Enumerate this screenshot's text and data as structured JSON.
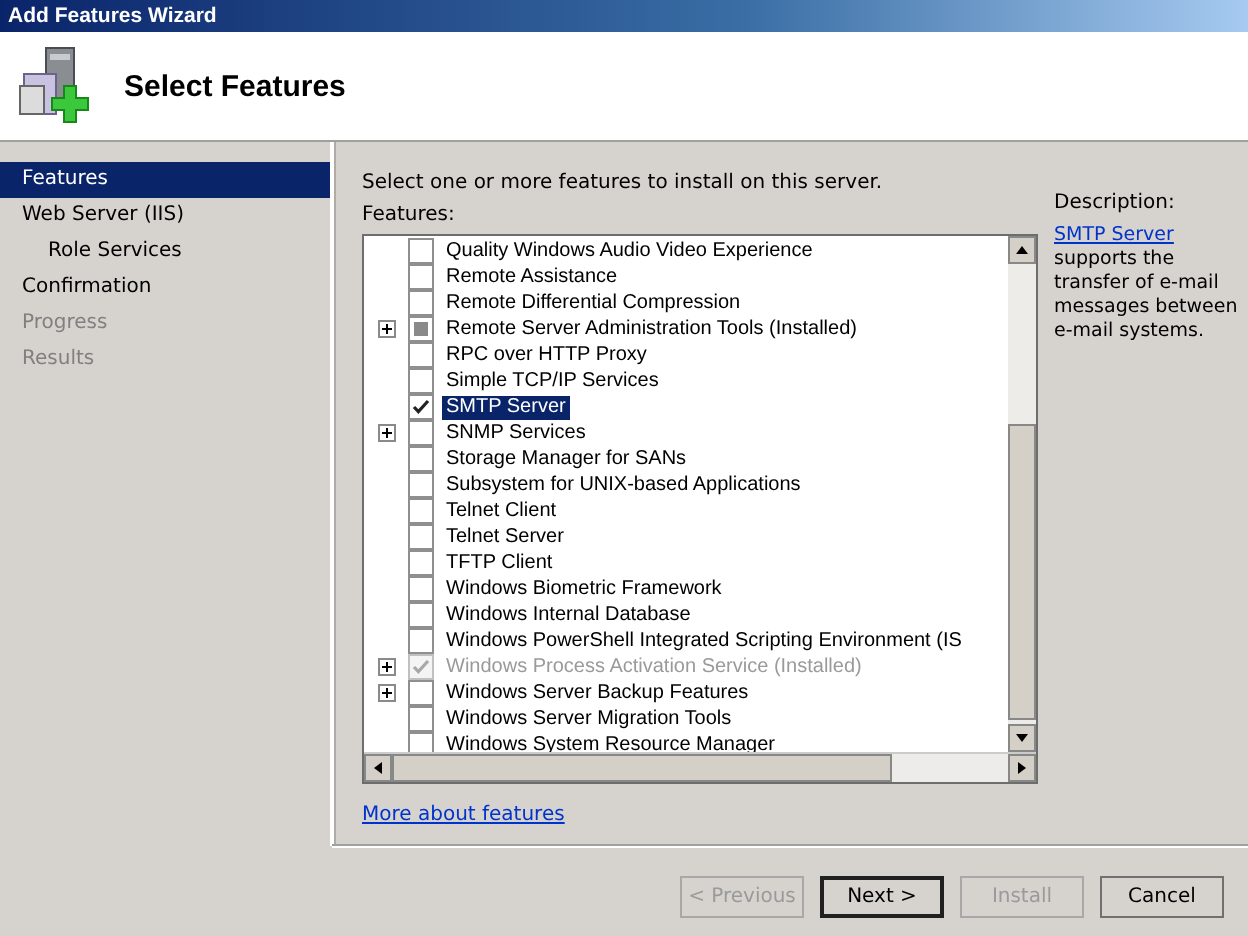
{
  "window": {
    "title": "Add Features Wizard"
  },
  "header": {
    "title": "Select Features"
  },
  "nav": [
    {
      "label": "Features",
      "selected": true,
      "disabled": false
    },
    {
      "label": "Web Server (IIS)",
      "selected": false,
      "disabled": false,
      "children": [
        {
          "label": "Role Services",
          "selected": false,
          "disabled": false
        }
      ]
    },
    {
      "label": "Confirmation",
      "selected": false,
      "disabled": false
    },
    {
      "label": "Progress",
      "selected": false,
      "disabled": true
    },
    {
      "label": "Results",
      "selected": false,
      "disabled": true
    }
  ],
  "instruction": "Select one or more features to install on this server.",
  "features_label": "Features:",
  "features": [
    {
      "label": "Quality Windows Audio Video Experience",
      "checked": false,
      "partial": false,
      "expandable": false,
      "disabled": false,
      "selected": false
    },
    {
      "label": "Remote Assistance",
      "checked": false,
      "partial": false,
      "expandable": false,
      "disabled": false,
      "selected": false
    },
    {
      "label": "Remote Differential Compression",
      "checked": false,
      "partial": false,
      "expandable": false,
      "disabled": false,
      "selected": false
    },
    {
      "label": "Remote Server Administration Tools  (Installed)",
      "checked": false,
      "partial": true,
      "expandable": true,
      "disabled": false,
      "selected": false
    },
    {
      "label": "RPC over HTTP Proxy",
      "checked": false,
      "partial": false,
      "expandable": false,
      "disabled": false,
      "selected": false
    },
    {
      "label": "Simple TCP/IP Services",
      "checked": false,
      "partial": false,
      "expandable": false,
      "disabled": false,
      "selected": false
    },
    {
      "label": "SMTP Server",
      "checked": true,
      "partial": false,
      "expandable": false,
      "disabled": false,
      "selected": true
    },
    {
      "label": "SNMP Services",
      "checked": false,
      "partial": false,
      "expandable": true,
      "disabled": false,
      "selected": false
    },
    {
      "label": "Storage Manager for SANs",
      "checked": false,
      "partial": false,
      "expandable": false,
      "disabled": false,
      "selected": false
    },
    {
      "label": "Subsystem for UNIX-based Applications",
      "checked": false,
      "partial": false,
      "expandable": false,
      "disabled": false,
      "selected": false
    },
    {
      "label": "Telnet Client",
      "checked": false,
      "partial": false,
      "expandable": false,
      "disabled": false,
      "selected": false
    },
    {
      "label": "Telnet Server",
      "checked": false,
      "partial": false,
      "expandable": false,
      "disabled": false,
      "selected": false
    },
    {
      "label": "TFTP Client",
      "checked": false,
      "partial": false,
      "expandable": false,
      "disabled": false,
      "selected": false
    },
    {
      "label": "Windows Biometric Framework",
      "checked": false,
      "partial": false,
      "expandable": false,
      "disabled": false,
      "selected": false
    },
    {
      "label": "Windows Internal Database",
      "checked": false,
      "partial": false,
      "expandable": false,
      "disabled": false,
      "selected": false
    },
    {
      "label": "Windows PowerShell Integrated Scripting Environment (IS",
      "checked": false,
      "partial": false,
      "expandable": false,
      "disabled": false,
      "selected": false
    },
    {
      "label": "Windows Process Activation Service  (Installed)",
      "checked": true,
      "partial": false,
      "expandable": true,
      "disabled": true,
      "selected": false
    },
    {
      "label": "Windows Server Backup Features",
      "checked": false,
      "partial": false,
      "expandable": true,
      "disabled": false,
      "selected": false
    },
    {
      "label": "Windows Server Migration Tools",
      "checked": false,
      "partial": false,
      "expandable": false,
      "disabled": false,
      "selected": false
    },
    {
      "label": "Windows System Resource Manager",
      "checked": false,
      "partial": false,
      "expandable": false,
      "disabled": false,
      "selected": false
    }
  ],
  "more_link": "More about features",
  "description": {
    "label": "Description:",
    "link": "SMTP Server",
    "text": " supports the transfer of e-mail messages between e-mail systems."
  },
  "buttons": [
    {
      "label": "< Previous",
      "disabled": true,
      "default": false
    },
    {
      "label": "Next >",
      "disabled": false,
      "default": true
    },
    {
      "label": "Install",
      "disabled": true,
      "default": false
    },
    {
      "label": "Cancel",
      "disabled": false,
      "default": false
    }
  ]
}
